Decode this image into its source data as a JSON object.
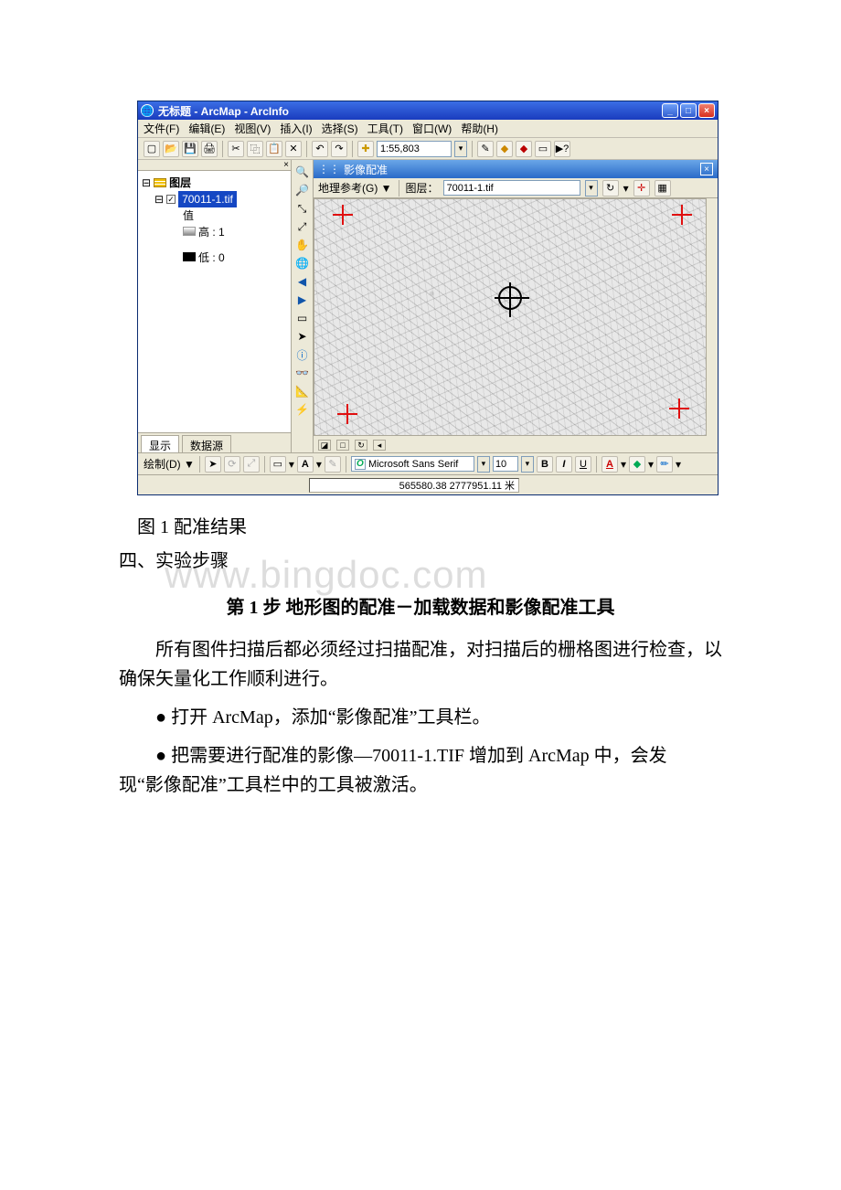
{
  "watermark": "www.bingdoc.com",
  "arcmap": {
    "title": "无标题 - ArcMap - ArcInfo",
    "winbtns": {
      "min": "_",
      "max": "□",
      "close": "×"
    },
    "menus": {
      "file": "文件(F)",
      "edit": "编辑(E)",
      "view": "视图(V)",
      "insert": "插入(I)",
      "select": "选择(S)",
      "tools": "工具(T)",
      "window": "窗口(W)",
      "help": "帮助(H)"
    },
    "scale": "1:55,803",
    "toc": {
      "root": "图层",
      "layer": "70011-1.tif",
      "value_label": "值",
      "high": "高 : 1",
      "low": "低 : 0",
      "tab_display": "显示",
      "tab_source": "数据源"
    },
    "georef": {
      "title": "影像配准",
      "menu": "地理参考(G) ▼",
      "layer_label": "图层：",
      "layer_value": "70011-1.tif"
    },
    "mapfooter": {
      "btn1": "◪",
      "btn2": "□",
      "btn3": "↻",
      "btn4": "◂"
    },
    "drawbar": {
      "label": "绘制(D) ▼",
      "font": "Microsoft Sans Serif",
      "size": "10",
      "bold": "B",
      "italic": "I",
      "underline": "U",
      "fontA": "A"
    },
    "status_coord": "565580.38  2777951.11 米"
  },
  "doc": {
    "caption": "图 1 配准结果",
    "section": "四、实验步骤",
    "step_title": "第 1 步 地形图的配准－加载数据和影像配准工具",
    "para_scan": "所有图件扫描后都必须经过扫描配准，对扫描后的栅格图进行检查，以确保矢量化工作顺利进行。",
    "bullet1": "● 打开 ArcMap，添加“影像配准”工具栏。",
    "bullet2a": "● 把需要进行配准的影像—70011-1.TIF 增加到 ArcMap 中，会发",
    "bullet2b": "现“影像配准”工具栏中的工具被激活。"
  }
}
